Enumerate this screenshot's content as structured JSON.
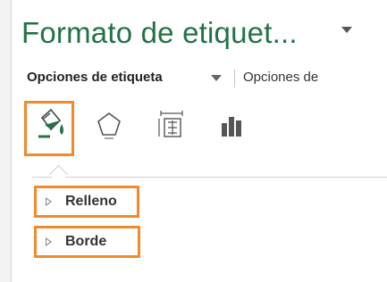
{
  "pane": {
    "title": "Formato de etiquet...",
    "tabs": [
      {
        "label": "Opciones de etiqueta",
        "active": true
      },
      {
        "label": "Opciones de",
        "active": false
      }
    ]
  },
  "icon_toolbar": [
    {
      "name": "fill-line-icon",
      "selected": true
    },
    {
      "name": "effects-pentagon-icon",
      "selected": false
    },
    {
      "name": "size-properties-icon",
      "selected": false
    },
    {
      "name": "label-options-chart-icon",
      "selected": false
    }
  ],
  "sections": [
    {
      "label": "Relleno",
      "expanded": false
    },
    {
      "label": "Borde",
      "expanded": false
    }
  ],
  "colors": {
    "title": "#217346",
    "highlight": "#f08a2c",
    "fill_icon": "#217346"
  }
}
